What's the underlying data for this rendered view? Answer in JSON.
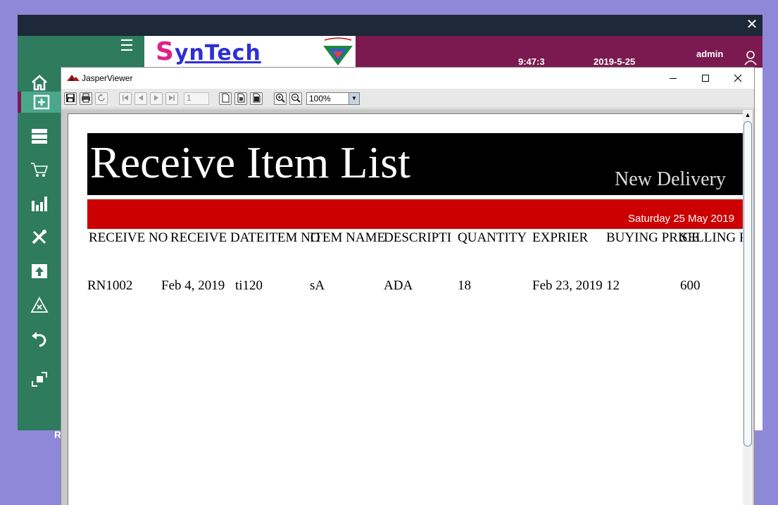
{
  "app": {
    "close_glyph": "✕",
    "logo": {
      "first": "S",
      "rest": "ynTech"
    },
    "header": {
      "time": "9:47:3",
      "date": "2019-5-25",
      "user": "admin"
    },
    "sidebar": {
      "items": [
        {
          "icon": "home-icon"
        },
        {
          "icon": "add-box-icon",
          "active": true
        },
        {
          "icon": "server-icon"
        },
        {
          "icon": "cart-icon"
        },
        {
          "icon": "bar-chart-icon"
        },
        {
          "icon": "tools-icon"
        },
        {
          "icon": "upload-icon"
        },
        {
          "icon": "warning-icon"
        },
        {
          "icon": "undo-icon"
        },
        {
          "icon": "transfer-icon"
        }
      ],
      "partial_label": "R"
    }
  },
  "viewer": {
    "title": "JasperViewer",
    "toolbar": {
      "page_number": "1",
      "zoom": "100%"
    },
    "report": {
      "title": "Receive Item List",
      "subtitle": "New Delivery",
      "date": "Saturday 25 May 2019",
      "columns": [
        "RECEIVE NO",
        "RECEIVE DATE",
        "ITEM NO",
        "ITEM NAME",
        "DESCRIPTI",
        "QUANTITY",
        "EXPRIER",
        "BUYING PRICE",
        "SELLING P"
      ],
      "rows": [
        [
          "RN1002",
          "Feb 4, 2019",
          "ti120",
          "sA",
          "ADA",
          "18",
          "Feb 23, 2019",
          "12",
          "600"
        ]
      ]
    }
  },
  "colors": {
    "app_topbar": "#1d2838",
    "header_accent": "#7a1a50",
    "sidebar": "#2e7b5e",
    "title_band": "#000000",
    "date_band": "#cc0000",
    "background": "#8f88d9"
  }
}
